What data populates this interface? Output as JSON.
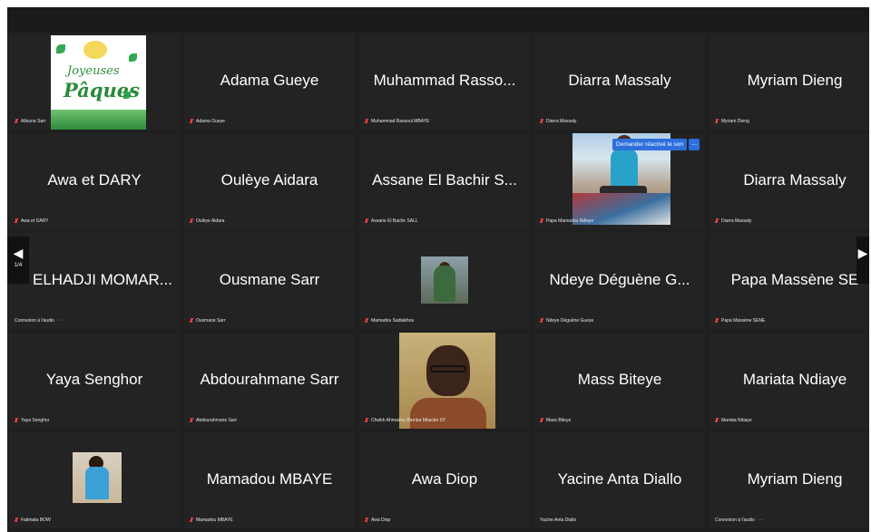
{
  "tiles": [
    {
      "name": "",
      "label": "Allouna Sarr",
      "muted": true
    },
    {
      "name": "Adama Gueye",
      "label": "Adama Gueye",
      "muted": true
    },
    {
      "name": "Muhammad Rasso...",
      "label": "Muhammad Rassoul MBAYE",
      "muted": true
    },
    {
      "name": "Diarra Massaly",
      "label": "Diarra Massaly",
      "muted": true
    },
    {
      "name": "Myriam Dieng",
      "label": "Myriam Dieng",
      "muted": true
    },
    {
      "name": "Awa et DARY",
      "label": "Awa et DARY",
      "muted": true
    },
    {
      "name": "Oulèye Aidara",
      "label": "Oulèye Aidara",
      "muted": true
    },
    {
      "name": "Assane El Bachir S...",
      "label": "Assane El Bachir SALL",
      "muted": true
    },
    {
      "name": "",
      "label": "Papa Mamadou Ndiaye",
      "muted": true
    },
    {
      "name": "Diarra Massaly",
      "label": "Diarra Massaly",
      "muted": true
    },
    {
      "name": "ELHADJI MOMAR...",
      "label": "Connexion à l'audio",
      "muted": false
    },
    {
      "name": "Ousmane Sarr",
      "label": "Ousmane Sarr",
      "muted": true
    },
    {
      "name": "",
      "label": "Mamadou Sadiakhou",
      "muted": true
    },
    {
      "name": "Ndeye Déguène G...",
      "label": "Ndeye Déguène Gueye",
      "muted": true
    },
    {
      "name": "Papa Massène SE",
      "label": "Papa Massène SENE",
      "muted": true
    },
    {
      "name": "Yaya Senghor",
      "label": "Yaya Senghor",
      "muted": true
    },
    {
      "name": "Abdourahmane Sarr",
      "label": "Abdourahmane Sarr",
      "muted": true
    },
    {
      "name": "",
      "label": "Cheikh Ahmadou Bamba Mbacké SY",
      "muted": true
    },
    {
      "name": "Mass Biteye",
      "label": "Mass Biteye",
      "muted": true
    },
    {
      "name": "Mariata Ndiaye",
      "label": "Mariata Ndiaye",
      "muted": true
    },
    {
      "name": "",
      "label": "Fatimata BOW",
      "muted": true
    },
    {
      "name": "Mamadou MBAYE",
      "label": "Mamadou MBAYE",
      "muted": true
    },
    {
      "name": "Awa Diop",
      "label": "Awa Diop",
      "muted": true
    },
    {
      "name": "Yacine Anta Diallo",
      "label": "Yacine Anta Diallo",
      "muted": false
    },
    {
      "name": "Myriam Dieng",
      "label": "Connexion à l'audio",
      "muted": false
    }
  ],
  "easter_card": {
    "line1": "Joyeuses",
    "line2": "Pâques"
  },
  "reactivate_sound": "Demander réactivé le son",
  "more_button": "...",
  "pagination": {
    "current": "1/4",
    "prev_arrow": "◀"
  },
  "colors": {
    "background": "#1f1f1f",
    "tile": "#232323",
    "muted_icon": "#ff4040",
    "button": "#2d6fdc"
  }
}
